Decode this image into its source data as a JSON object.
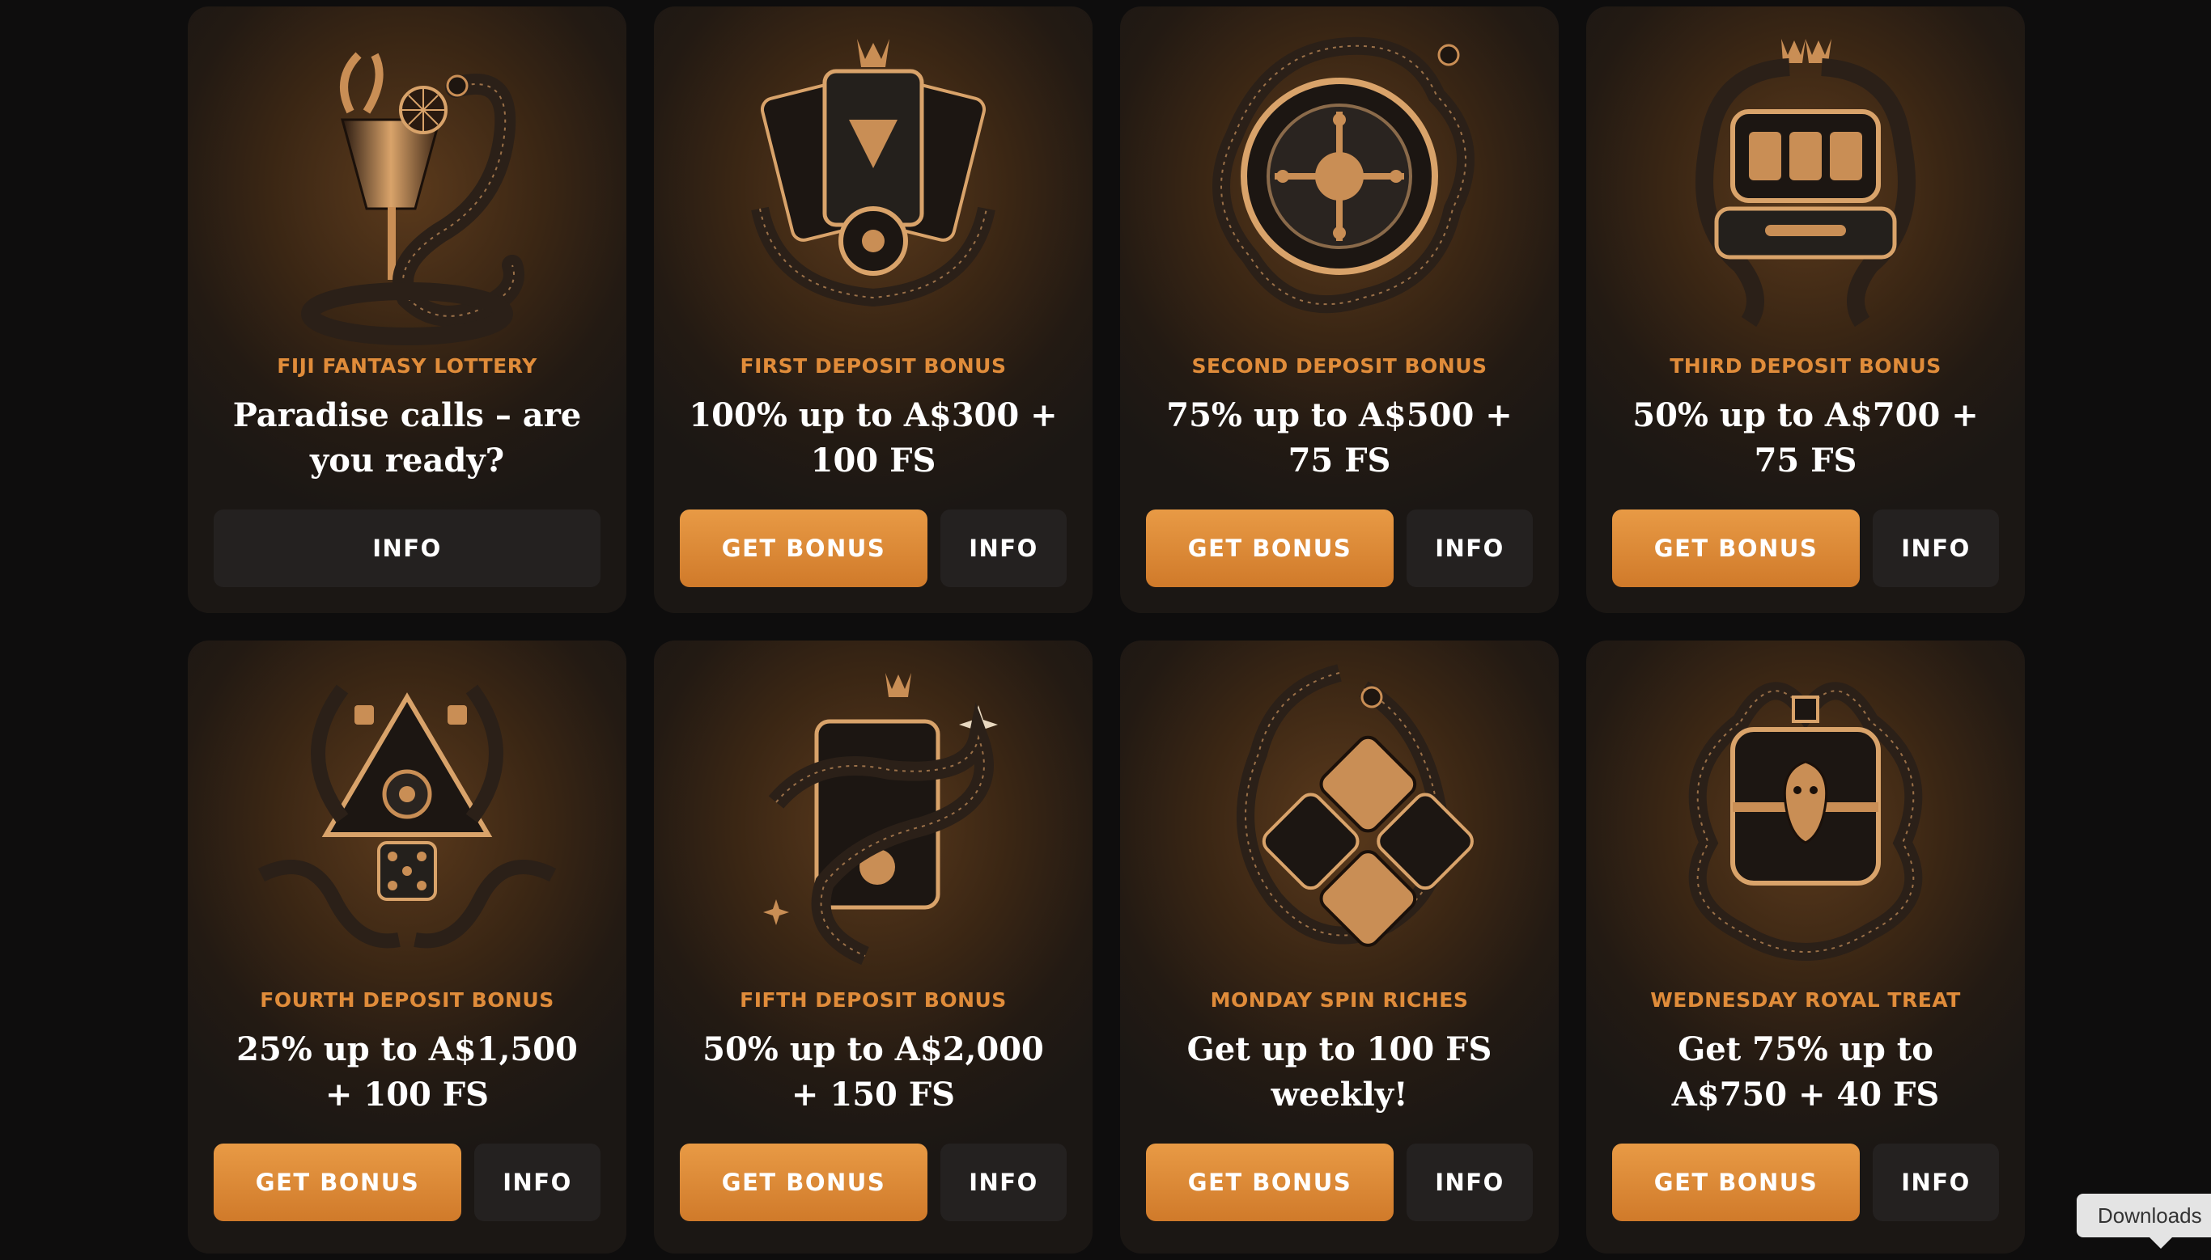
{
  "cards": [
    {
      "label": "FIJI FANTASY LOTTERY",
      "headline": "Paradise calls – are you ready?",
      "info": "INFO",
      "icon": "cocktail-snake-icon"
    },
    {
      "label": "FIRST DEPOSIT BONUS",
      "headline": "100% up to A$300 + 100 FS",
      "bonus": "GET BONUS",
      "info": "INFO",
      "icon": "cards-crown-snake-icon"
    },
    {
      "label": "SECOND DEPOSIT BONUS",
      "headline": "75% up to A$500 + 75 FS",
      "bonus": "GET BONUS",
      "info": "INFO",
      "icon": "roulette-snake-icon"
    },
    {
      "label": "THIRD DEPOSIT BONUS",
      "headline": "50% up to A$700 + 75 FS",
      "bonus": "GET BONUS",
      "info": "INFO",
      "icon": "slot-machine-snakes-icon"
    },
    {
      "label": "FOURTH DEPOSIT BONUS",
      "headline": "25% up to A$1,500 + 100 FS",
      "bonus": "GET BONUS",
      "info": "INFO",
      "icon": "dice-pyramid-snakes-icon"
    },
    {
      "label": "FIFTH DEPOSIT BONUS",
      "headline": "50% up to A$2,000 + 150 FS",
      "bonus": "GET BONUS",
      "info": "INFO",
      "icon": "card-snake-crown-icon"
    },
    {
      "label": "MONDAY SPIN RICHES",
      "headline": "Get up to 100 FS weekly!",
      "bonus": "GET BONUS",
      "info": "INFO",
      "icon": "dice-diamond-snakes-icon"
    },
    {
      "label": "WEDNESDAY ROYAL TREAT",
      "headline": "Get 75% up to A$750 + 40 FS",
      "bonus": "GET BONUS",
      "info": "INFO",
      "icon": "treasure-chest-snake-icon"
    }
  ],
  "downloads_tooltip": "Downloads",
  "colors": {
    "accent": "#e08c3a",
    "button": "#d98a38",
    "background": "#0e0d0d",
    "card": "#2a1d12"
  }
}
